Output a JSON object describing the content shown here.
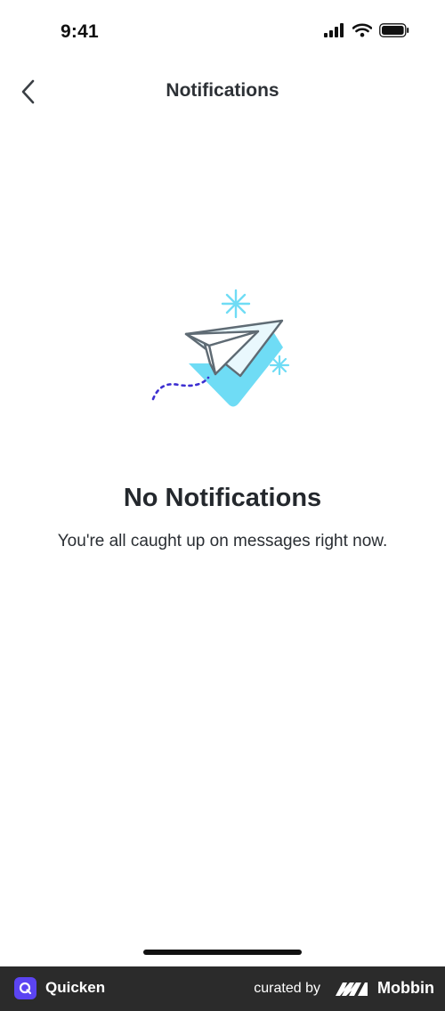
{
  "status_bar": {
    "time": "9:41",
    "icons": [
      "cellular-signal-icon",
      "wifi-icon",
      "battery-icon"
    ]
  },
  "nav": {
    "back_icon": "chevron-left-icon",
    "title": "Notifications"
  },
  "empty_state": {
    "illustration": "paper-plane-illustration",
    "title": "No Notifications",
    "subtitle": "You're all caught up on messages right now."
  },
  "footer": {
    "app_name": "Quicken",
    "curated_by": "curated by",
    "brand": "Mobbin"
  },
  "colors": {
    "accent_cyan": "#6fdcf5",
    "plane_stroke": "#5f6b74",
    "trail_purple": "#3d2fd1",
    "footer_bg": "#2b2b2b",
    "app_badge": "#5b44f2"
  }
}
